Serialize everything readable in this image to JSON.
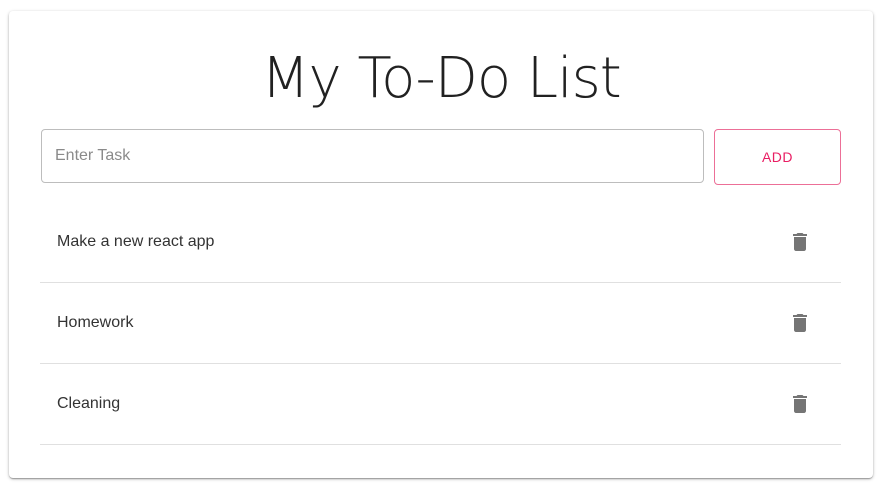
{
  "app": {
    "title": "My To-Do List"
  },
  "task_input": {
    "placeholder": "Enter Task",
    "value": ""
  },
  "add_button": {
    "label": "ADD"
  },
  "tasks": [
    {
      "label": "Make a new react app",
      "icon": "trash-icon"
    },
    {
      "label": "Homework",
      "icon": "trash-icon"
    },
    {
      "label": "Cleaning",
      "icon": "trash-icon"
    }
  ],
  "colors": {
    "accent": "#e91e63",
    "icon": "#757575",
    "divider": "#e0e0e0"
  }
}
